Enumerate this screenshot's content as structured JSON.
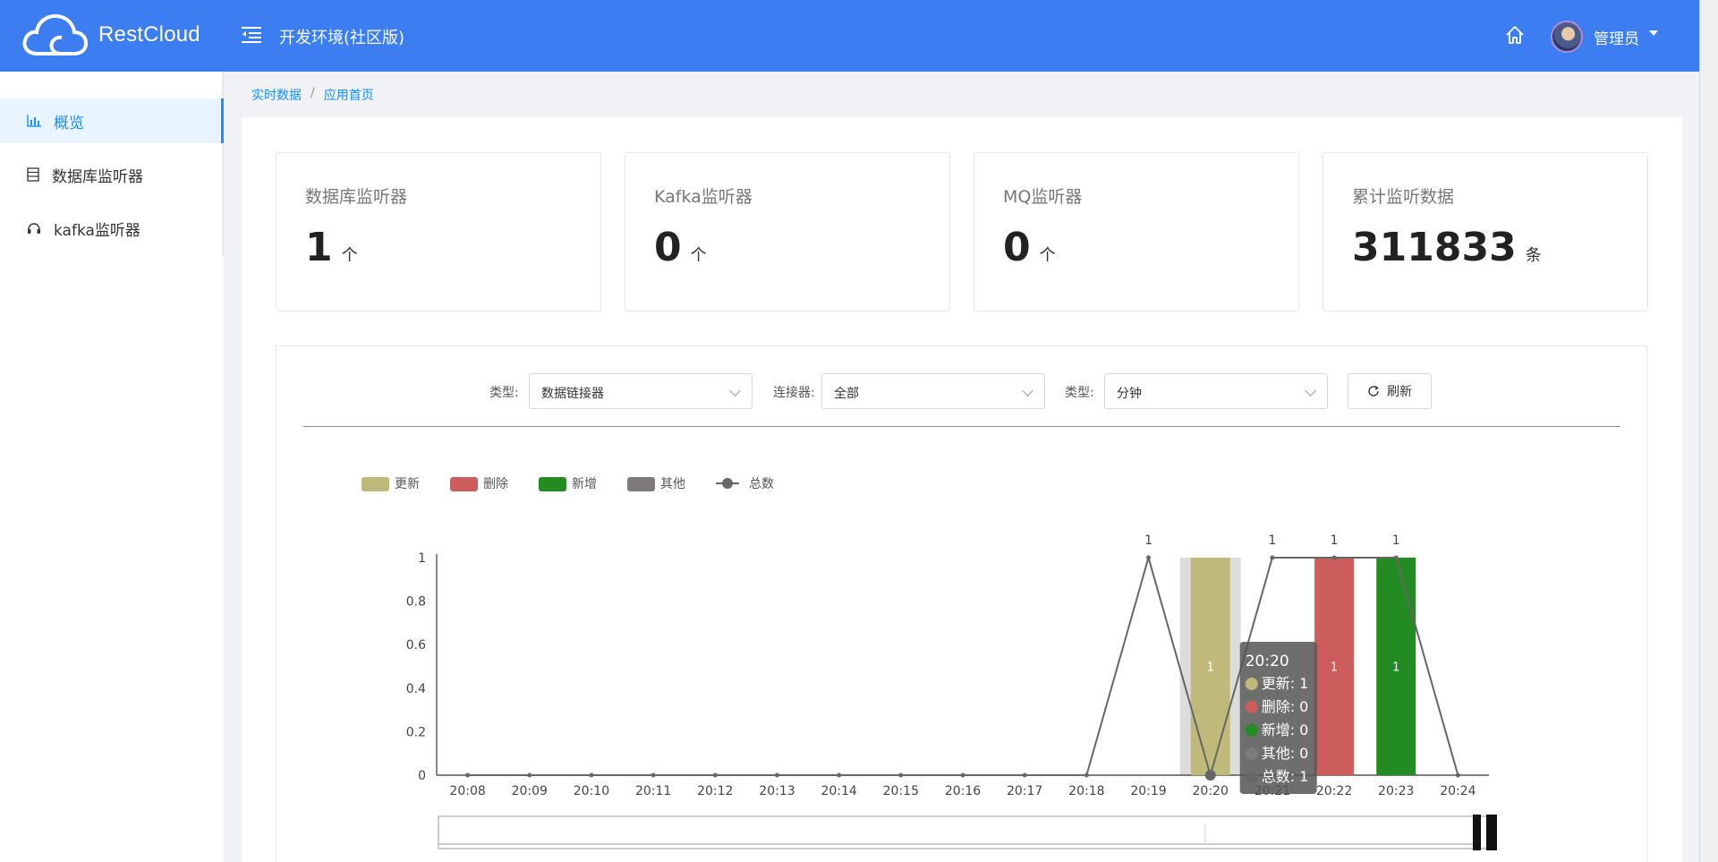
{
  "header": {
    "logo_text": "RestCloud",
    "env_title": "开发环境(社区版)",
    "user_name": "管理员"
  },
  "sidebar": {
    "items": [
      {
        "label": "概览",
        "icon": "bar-chart-icon",
        "active": true
      },
      {
        "label": "数据库监听器",
        "icon": "database-icon",
        "active": false
      },
      {
        "label": "kafka监听器",
        "icon": "headphones-icon",
        "active": false
      }
    ]
  },
  "breadcrumb": [
    "实时数据",
    "应用首页"
  ],
  "stats": [
    {
      "title": "数据库监听器",
      "value": "1",
      "unit": "个"
    },
    {
      "title": "Kafka监听器",
      "value": "0",
      "unit": "个"
    },
    {
      "title": "MQ监听器",
      "value": "0",
      "unit": "个"
    },
    {
      "title": "累计监听数据",
      "value": "311833",
      "unit": "条"
    }
  ],
  "filters": {
    "type_label": "类型:",
    "type_value": "数据链接器",
    "connector_label": "连接器:",
    "connector_value": "全部",
    "period_label": "类型:",
    "period_value": "分钟",
    "refresh_label": "刷新"
  },
  "chart_data": {
    "type": "bar",
    "categories": [
      "20:08",
      "20:09",
      "20:10",
      "20:11",
      "20:12",
      "20:13",
      "20:14",
      "20:15",
      "20:16",
      "20:17",
      "20:18",
      "20:19",
      "20:20",
      "20:21",
      "20:22",
      "20:23",
      "20:24"
    ],
    "series": [
      {
        "name": "更新",
        "type": "bar",
        "color": "#bfba7a",
        "values": [
          0,
          0,
          0,
          0,
          0,
          0,
          0,
          0,
          0,
          0,
          0,
          0,
          1,
          0,
          0,
          0,
          0
        ]
      },
      {
        "name": "删除",
        "type": "bar",
        "color": "#cd5c5c",
        "values": [
          0,
          0,
          0,
          0,
          0,
          0,
          0,
          0,
          0,
          0,
          0,
          0,
          0,
          0,
          1,
          0,
          0
        ]
      },
      {
        "name": "新增",
        "type": "bar",
        "color": "#228b22",
        "values": [
          0,
          0,
          0,
          0,
          0,
          0,
          0,
          0,
          0,
          0,
          0,
          0,
          0,
          0,
          0,
          1,
          0
        ]
      },
      {
        "name": "其他",
        "type": "bar",
        "color": "#7f7b7b",
        "values": [
          0,
          0,
          0,
          0,
          0,
          0,
          0,
          0,
          0,
          0,
          0,
          0,
          0,
          0,
          0,
          0,
          0
        ]
      },
      {
        "name": "总数",
        "type": "line",
        "color": "#666666",
        "values": [
          0,
          0,
          0,
          0,
          0,
          0,
          0,
          0,
          0,
          0,
          0,
          1,
          0,
          1,
          1,
          1,
          0
        ]
      }
    ],
    "y_ticks": [
      "0",
      "0.2",
      "0.4",
      "0.6",
      "0.8",
      "1"
    ],
    "ylim": [
      0,
      1
    ],
    "highlight_category": "20:20",
    "legend_position": "top-left",
    "tooltip": {
      "title": "20:20",
      "rows": [
        {
          "label": "更新: 1",
          "color": "#bfba7a"
        },
        {
          "label": "删除: 0",
          "color": "#cd5c5c"
        },
        {
          "label": "新增: 0",
          "color": "#228b22"
        },
        {
          "label": "其他: 0",
          "color": "#7f7b7b"
        },
        {
          "label": "总数: 1",
          "color": "#666666"
        }
      ]
    }
  }
}
